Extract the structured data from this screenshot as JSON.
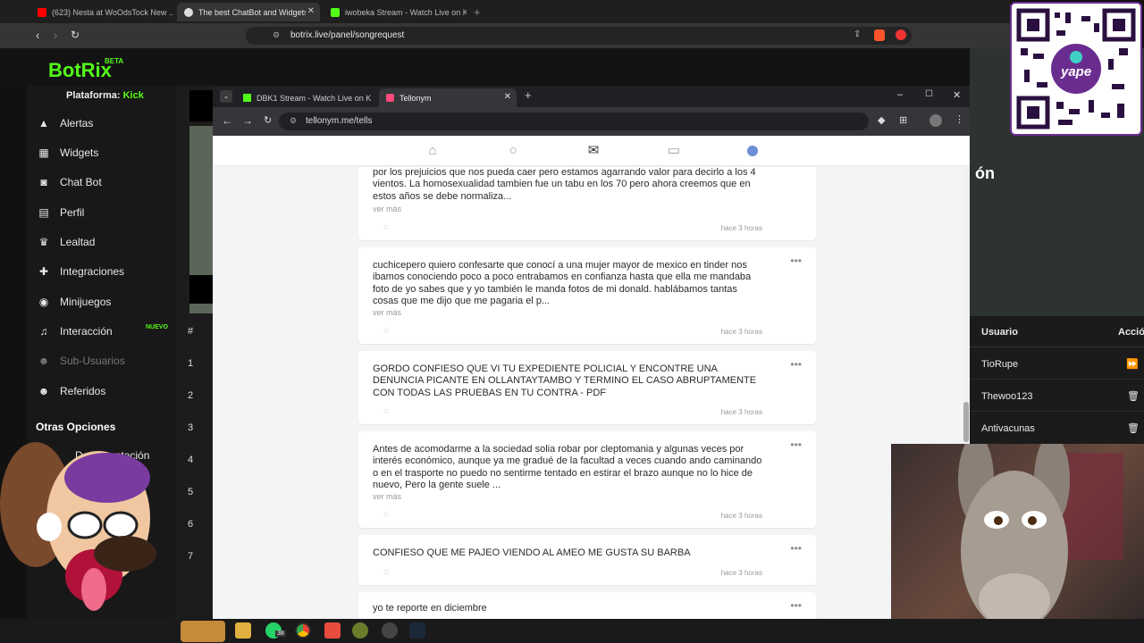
{
  "outer_browser": {
    "tabs": [
      {
        "label": "(623) Nesta at WoOdsTock New ..."
      },
      {
        "label": "The best ChatBot and Widgets f..."
      },
      {
        "label": "iwobeka Stream - Watch Live on Kick"
      }
    ],
    "url": "botrix.live/panel/songrequest"
  },
  "botrix": {
    "logo": "BotRix",
    "beta": "BETA",
    "platform_label": "Plataforma:",
    "platform_value": "Kick",
    "menu": [
      {
        "label": "Alertas",
        "icon": "warning-icon"
      },
      {
        "label": "Widgets",
        "icon": "grid-icon"
      },
      {
        "label": "Chat Bot",
        "icon": "robot-icon"
      },
      {
        "label": "Perfil",
        "icon": "profile-card-icon"
      },
      {
        "label": "Lealtad",
        "icon": "trophy-icon"
      },
      {
        "label": "Integraciones",
        "icon": "puzzle-icon"
      },
      {
        "label": "Minijuegos",
        "icon": "gamepad-icon"
      },
      {
        "label": "Interacción",
        "icon": "music-icon"
      },
      {
        "label": "Sub-Usuarios",
        "icon": "users-icon"
      },
      {
        "label": "Referidos",
        "icon": "users-icon"
      }
    ],
    "new_badge": "NUEVO",
    "other_options": "Otras Opciones",
    "documentation": "Documentación",
    "table_hash": "#",
    "row_numbers": [
      "1",
      "2",
      "3",
      "4",
      "5",
      "6",
      "7"
    ]
  },
  "inner_browser": {
    "tabs": [
      {
        "label": "DBK1 Stream - Watch Live on K"
      },
      {
        "label": "Tellonym"
      }
    ],
    "url": "tellonym.me/tells"
  },
  "tells": [
    {
      "text": "por los prejuicios que nos pueda caer pero estamos agarrando valor para decirlo a los 4 vientos. La homosexualidad tambien fue un tabu en los 70 pero ahora creemos que en estos años se debe normaliza...",
      "more": "ver más",
      "time": "hace 3 horas"
    },
    {
      "text": "cuchicepero quiero confesarte que conocí a una mujer mayor de mexico en tinder nos ibamos conociendo poco a poco entrabamos en confianza hasta que ella me mandaba foto de yo sabes que y yo también le manda fotos de mi donald. hablábamos tantas cosas que me dijo que me pagaria el p...",
      "more": "ver más",
      "time": "hace 3 horas"
    },
    {
      "text": "GORDO CONFIESO QUE VI TU EXPEDIENTE POLICIAL Y ENCONTRE UNA DENUNCIA PICANTE EN OLLANTAYTAMBO Y TERMINO EL CASO ABRUPTAMENTE CON TODAS LAS PRUEBAS EN TU CONTRA - PDF",
      "more": "",
      "time": "hace 3 horas"
    },
    {
      "text": "Antes de acomodarme a la sociedad solia robar por cleptomania y algunas veces por interés económico, aunque ya me gradué de la facultad a veces cuando ando caminando o en el trasporte no puedo no sentirme tentado en estirar el brazo aunque no lo hice de nuevo, Pero la gente suele ...",
      "more": "ver más",
      "time": "hace 3 horas"
    },
    {
      "text": "CONFIESO QUE ME PAJEO VIENDO AL AMEO ME GUSTA SU BARBA",
      "more": "",
      "time": "hace 3 horas"
    },
    {
      "text": "yo te reporte en diciembre",
      "more": "",
      "time": ""
    }
  ],
  "right_panel": {
    "overlay_text": "ón",
    "col_user": "Usuario",
    "col_action": "Acció",
    "users": [
      "TioRupe",
      "Thewoo123",
      "Antivacunas"
    ]
  },
  "taskbar": {
    "whatsapp_badge": "38"
  },
  "qr": {
    "label": "yape"
  },
  "colors": {
    "accent_green": "#53fc18",
    "kick_green": "#53fc18",
    "yape_purple": "#6a2d8f"
  }
}
